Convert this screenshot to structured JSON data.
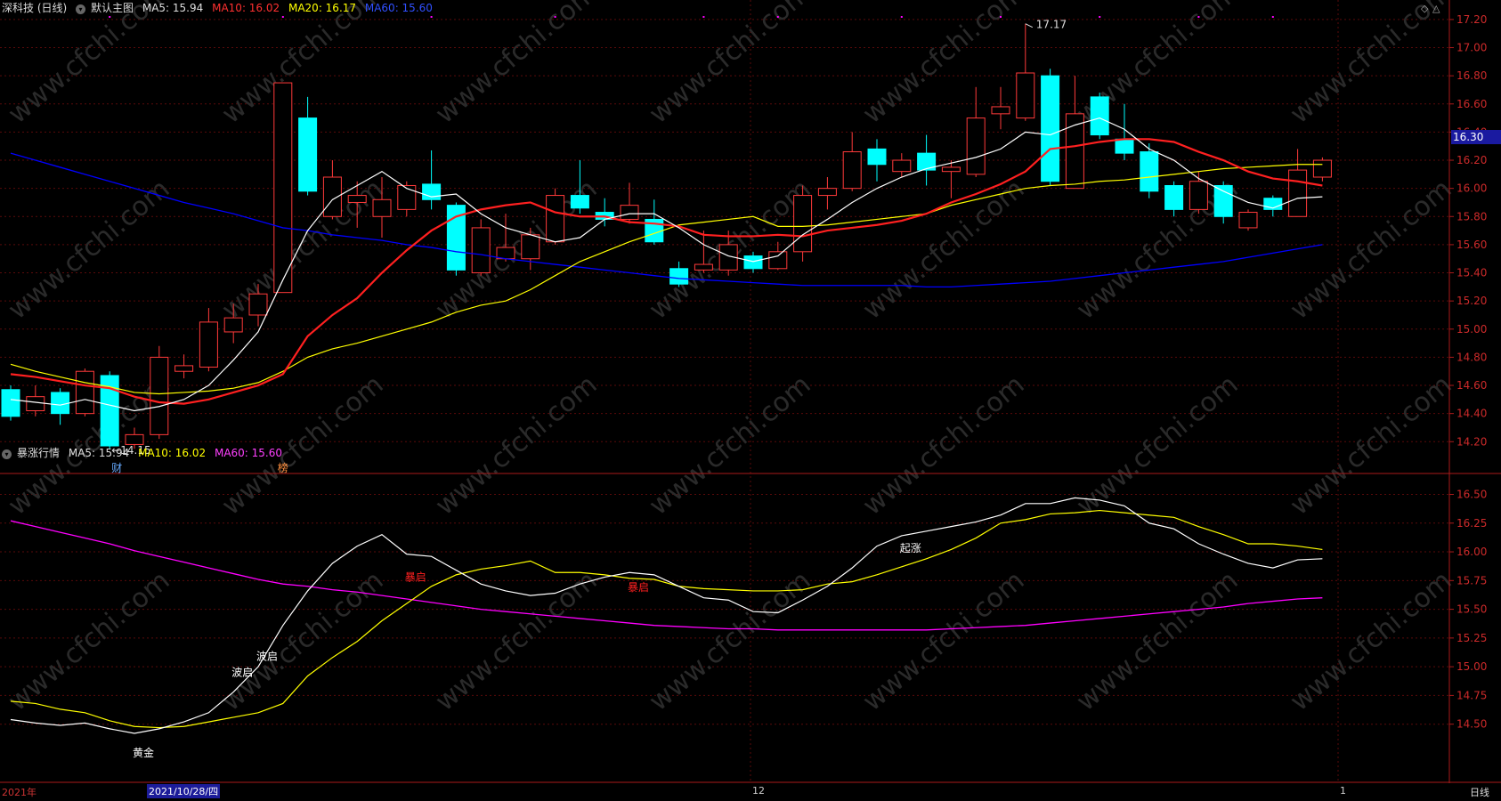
{
  "header_main": {
    "stock": "深科技 (日线)",
    "view": "默认主图",
    "ma5": "MA5: 15.94",
    "ma10": "MA10: 16.02",
    "ma20": "MA20: 16.17",
    "ma60": "MA60: 15.60"
  },
  "header_sub": {
    "name": "暴涨行情",
    "ma5": "MA5: 15.94",
    "ma10": "MA10: 16.02",
    "ma60": "MA60: 15.60"
  },
  "price_box": "16.30",
  "bottom_axis": {
    "year": "2021年",
    "cursor_date": "2021/10/28/四",
    "dec": "12",
    "jan": "1",
    "period": "日线"
  },
  "colors": {
    "up": "#ff3a3a",
    "down": "#00ffff",
    "ma5": "#ffffff",
    "ma10": "#ff2020",
    "ma20": "#ffff00",
    "ma60": "#0000ff",
    "sub_ma60": "#ff00ff"
  },
  "chart_data": [
    {
      "type": "candlestick",
      "title": "深科技 (日线)",
      "yticks": [
        "17.20",
        "17.00",
        "16.80",
        "16.60",
        "16.40",
        "16.20",
        "16.00",
        "15.80",
        "15.60",
        "15.40",
        "15.20",
        "15.00",
        "14.80",
        "14.60",
        "14.40",
        "14.20"
      ],
      "ylim": [
        14.05,
        17.25
      ],
      "candles": [
        {
          "o": 14.57,
          "c": 14.38,
          "h": 14.6,
          "l": 14.35
        },
        {
          "o": 14.42,
          "c": 14.52,
          "h": 14.6,
          "l": 14.38
        },
        {
          "o": 14.55,
          "c": 14.4,
          "h": 14.58,
          "l": 14.32
        },
        {
          "o": 14.4,
          "c": 14.7,
          "h": 14.72,
          "l": 14.38
        },
        {
          "o": 14.67,
          "c": 14.17,
          "h": 14.7,
          "l": 14.15
        },
        {
          "o": 14.18,
          "c": 14.25,
          "h": 14.3,
          "l": 14.15
        },
        {
          "o": 14.25,
          "c": 14.8,
          "h": 14.88,
          "l": 14.22
        },
        {
          "o": 14.7,
          "c": 14.74,
          "h": 14.82,
          "l": 14.65
        },
        {
          "o": 14.73,
          "c": 15.05,
          "h": 15.15,
          "l": 14.7
        },
        {
          "o": 14.98,
          "c": 15.08,
          "h": 15.18,
          "l": 14.9
        },
        {
          "o": 15.1,
          "c": 15.25,
          "h": 15.32,
          "l": 15.02
        },
        {
          "o": 15.26,
          "c": 16.75,
          "h": 16.75,
          "l": 15.26
        },
        {
          "o": 16.5,
          "c": 15.98,
          "h": 16.65,
          "l": 15.95
        },
        {
          "o": 15.8,
          "c": 16.08,
          "h": 16.2,
          "l": 15.78
        },
        {
          "o": 15.9,
          "c": 15.95,
          "h": 16.05,
          "l": 15.72
        },
        {
          "o": 15.8,
          "c": 15.92,
          "h": 16.08,
          "l": 15.65
        },
        {
          "o": 15.85,
          "c": 16.02,
          "h": 16.05,
          "l": 15.8
        },
        {
          "o": 16.03,
          "c": 15.92,
          "h": 16.27,
          "l": 15.85
        },
        {
          "o": 15.88,
          "c": 15.42,
          "h": 15.9,
          "l": 15.38
        },
        {
          "o": 15.4,
          "c": 15.72,
          "h": 15.78,
          "l": 15.38
        },
        {
          "o": 15.5,
          "c": 15.58,
          "h": 15.82,
          "l": 15.48
        },
        {
          "o": 15.5,
          "c": 15.67,
          "h": 15.72,
          "l": 15.42
        },
        {
          "o": 15.62,
          "c": 15.95,
          "h": 16.0,
          "l": 15.6
        },
        {
          "o": 15.95,
          "c": 15.86,
          "h": 16.2,
          "l": 15.82
        },
        {
          "o": 15.83,
          "c": 15.78,
          "h": 15.93,
          "l": 15.73
        },
        {
          "o": 15.78,
          "c": 15.88,
          "h": 16.04,
          "l": 15.75
        },
        {
          "o": 15.78,
          "c": 15.62,
          "h": 15.92,
          "l": 15.6
        },
        {
          "o": 15.43,
          "c": 15.32,
          "h": 15.48,
          "l": 15.3
        },
        {
          "o": 15.42,
          "c": 15.46,
          "h": 15.7,
          "l": 15.4
        },
        {
          "o": 15.42,
          "c": 15.6,
          "h": 15.7,
          "l": 15.38
        },
        {
          "o": 15.52,
          "c": 15.43,
          "h": 15.55,
          "l": 15.4
        },
        {
          "o": 15.43,
          "c": 15.55,
          "h": 15.62,
          "l": 15.42
        },
        {
          "o": 15.55,
          "c": 15.95,
          "h": 16.02,
          "l": 15.48
        },
        {
          "o": 15.95,
          "c": 16.0,
          "h": 16.08,
          "l": 15.85
        },
        {
          "o": 16.0,
          "c": 16.26,
          "h": 16.4,
          "l": 15.98
        },
        {
          "o": 16.28,
          "c": 16.17,
          "h": 16.35,
          "l": 16.05
        },
        {
          "o": 16.12,
          "c": 16.2,
          "h": 16.25,
          "l": 16.08
        },
        {
          "o": 16.25,
          "c": 16.13,
          "h": 16.38,
          "l": 16.02
        },
        {
          "o": 16.12,
          "c": 16.15,
          "h": 16.2,
          "l": 15.93
        },
        {
          "o": 16.1,
          "c": 16.5,
          "h": 16.72,
          "l": 16.08
        },
        {
          "o": 16.53,
          "c": 16.58,
          "h": 16.72,
          "l": 16.42
        },
        {
          "o": 16.5,
          "c": 16.82,
          "h": 17.17,
          "l": 16.48
        },
        {
          "o": 16.8,
          "c": 16.05,
          "h": 16.85,
          "l": 16.02
        },
        {
          "o": 16.0,
          "c": 16.53,
          "h": 16.8,
          "l": 16.0
        },
        {
          "o": 16.65,
          "c": 16.38,
          "h": 16.68,
          "l": 16.35
        },
        {
          "o": 16.35,
          "c": 16.25,
          "h": 16.6,
          "l": 16.2
        },
        {
          "o": 16.26,
          "c": 15.98,
          "h": 16.32,
          "l": 15.93
        },
        {
          "o": 16.02,
          "c": 15.85,
          "h": 16.05,
          "l": 15.8
        },
        {
          "o": 15.85,
          "c": 16.05,
          "h": 16.12,
          "l": 15.82
        },
        {
          "o": 16.02,
          "c": 15.8,
          "h": 16.05,
          "l": 15.75
        },
        {
          "o": 15.72,
          "c": 15.83,
          "h": 15.85,
          "l": 15.7
        },
        {
          "o": 15.93,
          "c": 15.85,
          "h": 15.95,
          "l": 15.8
        },
        {
          "o": 15.8,
          "c": 16.13,
          "h": 16.28,
          "l": 15.8
        },
        {
          "o": 16.08,
          "c": 16.2,
          "h": 16.22,
          "l": 16.05
        }
      ],
      "ma5": [
        14.5,
        14.48,
        14.46,
        14.5,
        14.46,
        14.42,
        14.45,
        14.5,
        14.6,
        14.78,
        14.98,
        15.35,
        15.7,
        15.92,
        16.02,
        16.12,
        16.0,
        15.94,
        15.96,
        15.82,
        15.72,
        15.67,
        15.62,
        15.65,
        15.78,
        15.82,
        15.82,
        15.72,
        15.6,
        15.52,
        15.48,
        15.52,
        15.67,
        15.78,
        15.9,
        16.0,
        16.08,
        16.14,
        16.18,
        16.22,
        16.28,
        16.4,
        16.38,
        16.45,
        16.5,
        16.42,
        16.28,
        16.2,
        16.07,
        15.98,
        15.9,
        15.86,
        15.93,
        15.94
      ],
      "ma10": [
        14.68,
        14.66,
        14.63,
        14.6,
        14.58,
        14.52,
        14.48,
        14.47,
        14.5,
        14.55,
        14.6,
        14.68,
        14.95,
        15.1,
        15.22,
        15.4,
        15.56,
        15.7,
        15.8,
        15.85,
        15.88,
        15.9,
        15.83,
        15.8,
        15.8,
        15.76,
        15.75,
        15.73,
        15.67,
        15.66,
        15.66,
        15.67,
        15.66,
        15.7,
        15.72,
        15.74,
        15.77,
        15.82,
        15.9,
        15.96,
        16.03,
        16.12,
        16.28,
        16.3,
        16.33,
        16.35,
        16.35,
        16.33,
        16.26,
        16.2,
        16.12,
        16.07,
        16.05,
        16.02
      ],
      "ma20": [
        14.75,
        14.7,
        14.66,
        14.62,
        14.59,
        14.55,
        14.54,
        14.55,
        14.56,
        14.58,
        14.62,
        14.7,
        14.8,
        14.86,
        14.9,
        14.95,
        15.0,
        15.05,
        15.12,
        15.17,
        15.2,
        15.28,
        15.38,
        15.48,
        15.55,
        15.62,
        15.68,
        15.74,
        15.76,
        15.78,
        15.8,
        15.73,
        15.73,
        15.74,
        15.76,
        15.78,
        15.8,
        15.82,
        15.88,
        15.92,
        15.96,
        16.0,
        16.02,
        16.03,
        16.05,
        16.06,
        16.08,
        16.1,
        16.12,
        16.14,
        16.15,
        16.16,
        16.17,
        16.17
      ],
      "ma60": [
        16.25,
        16.2,
        16.15,
        16.1,
        16.05,
        16.0,
        15.95,
        15.9,
        15.86,
        15.82,
        15.77,
        15.72,
        15.7,
        15.67,
        15.65,
        15.63,
        15.6,
        15.58,
        15.55,
        15.53,
        15.5,
        15.48,
        15.46,
        15.44,
        15.42,
        15.4,
        15.38,
        15.36,
        15.35,
        15.34,
        15.33,
        15.32,
        15.31,
        15.31,
        15.31,
        15.31,
        15.31,
        15.3,
        15.3,
        15.31,
        15.32,
        15.33,
        15.34,
        15.36,
        15.38,
        15.4,
        15.42,
        15.44,
        15.46,
        15.48,
        15.51,
        15.54,
        15.57,
        15.6
      ],
      "annotations": [
        "17.17",
        "14.15",
        "财",
        "榜"
      ]
    },
    {
      "type": "line",
      "title": "暴涨行情",
      "yticks": [
        "16.50",
        "16.25",
        "16.00",
        "15.75",
        "15.50",
        "15.25",
        "15.00",
        "14.75",
        "14.50"
      ],
      "ylim": [
        14.18,
        16.62
      ],
      "series": [
        {
          "name": "MA5",
          "values": [
            14.54,
            14.51,
            14.49,
            14.51,
            14.46,
            14.42,
            14.46,
            14.52,
            14.6,
            14.78,
            15.0,
            15.36,
            15.66,
            15.9,
            16.05,
            16.15,
            15.98,
            15.96,
            15.84,
            15.72,
            15.66,
            15.62,
            15.64,
            15.72,
            15.78,
            15.82,
            15.8,
            15.7,
            15.6,
            15.58,
            15.48,
            15.47,
            15.58,
            15.7,
            15.86,
            16.05,
            16.14,
            16.18,
            16.22,
            16.26,
            16.32,
            16.42,
            16.42,
            16.47,
            16.45,
            16.4,
            16.25,
            16.2,
            16.07,
            15.98,
            15.9,
            15.86,
            15.93,
            15.94
          ]
        },
        {
          "name": "MA10",
          "values": [
            14.7,
            14.68,
            14.63,
            14.6,
            14.53,
            14.48,
            14.47,
            14.48,
            14.52,
            14.56,
            14.6,
            14.68,
            14.92,
            15.08,
            15.22,
            15.4,
            15.55,
            15.7,
            15.8,
            15.85,
            15.88,
            15.92,
            15.82,
            15.82,
            15.8,
            15.77,
            15.76,
            15.7,
            15.68,
            15.67,
            15.66,
            15.66,
            15.67,
            15.72,
            15.74,
            15.8,
            15.87,
            15.94,
            16.02,
            16.12,
            16.25,
            16.28,
            16.33,
            16.34,
            16.36,
            16.34,
            16.32,
            16.3,
            16.22,
            16.15,
            16.07,
            16.07,
            16.05,
            16.02
          ]
        },
        {
          "name": "MA60",
          "values": [
            16.27,
            16.22,
            16.17,
            16.12,
            16.07,
            16.01,
            15.96,
            15.91,
            15.86,
            15.81,
            15.76,
            15.72,
            15.7,
            15.67,
            15.65,
            15.62,
            15.59,
            15.56,
            15.53,
            15.5,
            15.48,
            15.46,
            15.44,
            15.42,
            15.4,
            15.38,
            15.36,
            15.35,
            15.34,
            15.33,
            15.33,
            15.32,
            15.32,
            15.32,
            15.32,
            15.32,
            15.32,
            15.32,
            15.33,
            15.34,
            15.35,
            15.36,
            15.38,
            15.4,
            15.42,
            15.44,
            15.46,
            15.48,
            15.5,
            15.52,
            15.55,
            15.57,
            15.59,
            15.6
          ]
        }
      ],
      "annotations": [
        "黄金",
        "波启",
        "波启",
        "暴启",
        "暴启",
        "起涨"
      ]
    }
  ]
}
